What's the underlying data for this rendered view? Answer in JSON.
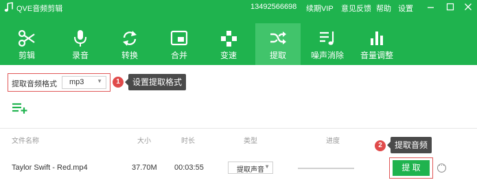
{
  "window": {
    "title": "QVE音频剪辑",
    "phone": "13492566698",
    "renew_vip": "续期VIP",
    "feedback": "意见反馈",
    "help": "帮助",
    "settings": "设置",
    "brand_color": "#1fb34e"
  },
  "toolbar": {
    "active_index": 5,
    "items": [
      {
        "label": "剪辑",
        "icon": "scissors-icon"
      },
      {
        "label": "录音",
        "icon": "microphone-icon"
      },
      {
        "label": "转换",
        "icon": "convert-arrows-icon"
      },
      {
        "label": "合并",
        "icon": "merge-icon"
      },
      {
        "label": "变速",
        "icon": "speed-icon"
      },
      {
        "label": "提取",
        "icon": "shuffle-icon"
      },
      {
        "label": "噪声消除",
        "icon": "noise-removal-icon"
      },
      {
        "label": "音量调整",
        "icon": "volume-bars-icon"
      }
    ]
  },
  "format": {
    "label": "提取音频格式",
    "selected": "mp3",
    "arrow": "▼"
  },
  "annotations": {
    "step1_number": "1",
    "step1_text": "设置提取格式",
    "step2_number": "2",
    "step2_text": "提取音频"
  },
  "table": {
    "headers": {
      "name": "文件名称",
      "size": "大小",
      "duration": "时长",
      "type": "类型",
      "progress": "进度"
    },
    "rows": [
      {
        "name": "Taylor Swift - Red.mp4",
        "size": "37.70M",
        "duration": "00:03:55",
        "type": "提取声音",
        "type_arrow": "▼",
        "progress": 0,
        "action": "提 取",
        "more": "···"
      }
    ]
  }
}
